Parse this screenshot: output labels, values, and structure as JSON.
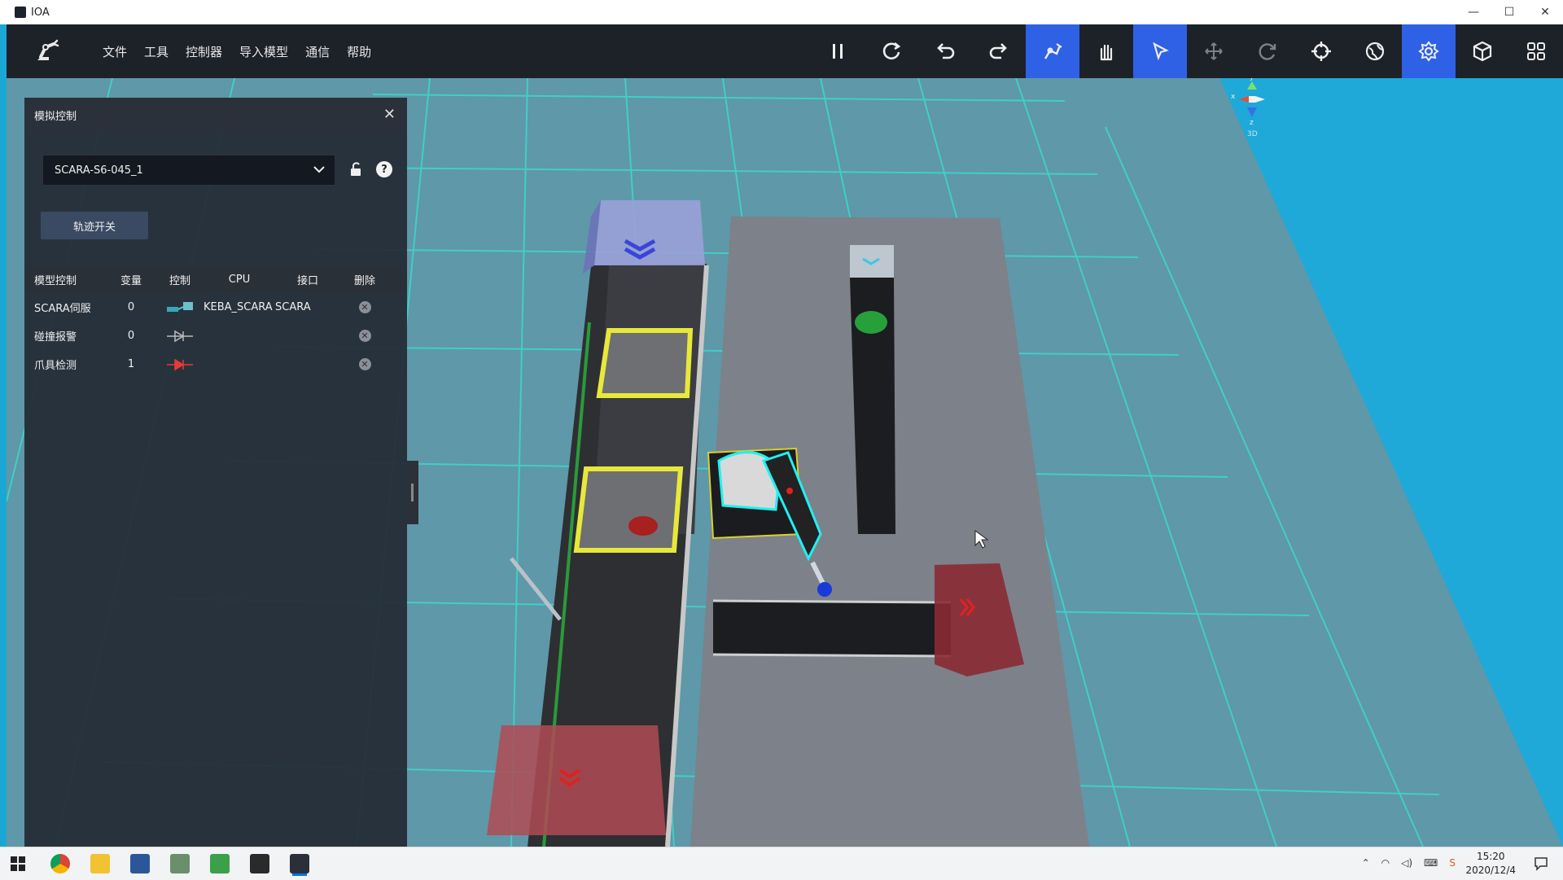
{
  "window": {
    "title": "IOA",
    "controls": [
      "—",
      "☐",
      "✕"
    ]
  },
  "menu": [
    "文件",
    "工具",
    "控制器",
    "导入模型",
    "通信",
    "帮助"
  ],
  "toolbar": [
    "pause-icon",
    "refresh-icon",
    "undo-icon",
    "redo-icon",
    "robot-arm-icon",
    "drag-hand-icon",
    "cursor-icon",
    "move-icon",
    "rotate-icon",
    "crosshair-icon",
    "globe-icon",
    "settings-icon",
    "cube-icon",
    "grid-icon"
  ],
  "panel": {
    "title": "模拟控制",
    "robot": "SCARA-S6-045_1",
    "trace_button": "轨迹开关",
    "headers": [
      "模型控制",
      "变量",
      "控制",
      "CPU",
      "接口",
      "删除"
    ],
    "rows": [
      {
        "name": "SCARA伺服",
        "value": "0",
        "cpu": "KEBA_SCARA",
        "interface": "SCARA"
      },
      {
        "name": "碰撞报警",
        "value": "0",
        "cpu": "",
        "interface": ""
      },
      {
        "name": "爪具检测",
        "value": "1",
        "cpu": "",
        "interface": ""
      }
    ]
  },
  "axis": {
    "view_label": "3D",
    "x": "x",
    "y": "y",
    "z": "z"
  },
  "taskbar": {
    "time": "15:20",
    "date": "2020/12/4"
  },
  "colors": {
    "toolbar_active": "#2f61e6",
    "toolbar_bg": "#1d2128",
    "floor": "#1aa7d6"
  }
}
